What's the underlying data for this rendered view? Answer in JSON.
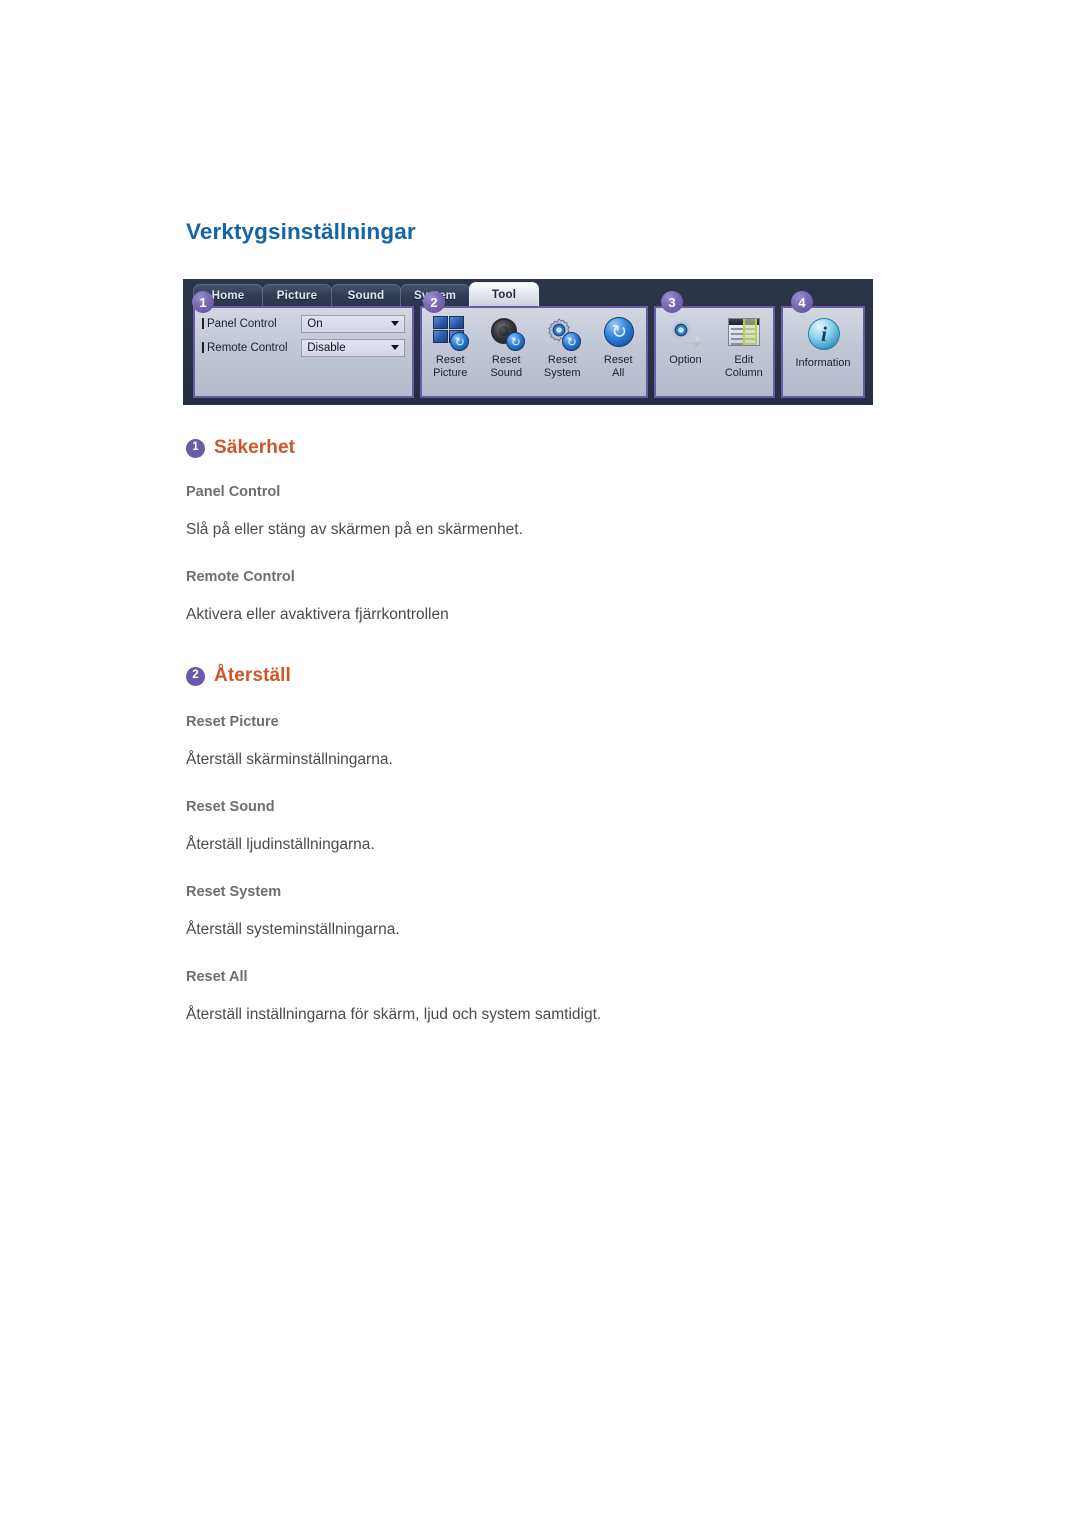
{
  "page": {
    "title": "Verktygsinställningar"
  },
  "figure": {
    "name": "tool-tab-toolbar-screenshot",
    "tabs": [
      {
        "label": "Home",
        "active": false
      },
      {
        "label": "Picture",
        "active": false
      },
      {
        "label": "Sound",
        "active": false
      },
      {
        "label": "System",
        "active": false
      },
      {
        "label": "Tool",
        "active": true
      }
    ],
    "callouts": [
      "1",
      "2",
      "3",
      "4"
    ],
    "group1": {
      "settings": [
        {
          "label": "Panel Control",
          "value": "On"
        },
        {
          "label": "Remote Control",
          "value": "Disable"
        }
      ]
    },
    "group2": {
      "buttons": [
        {
          "label": "Reset\nPicture",
          "icon": "reset-picture-icon"
        },
        {
          "label": "Reset\nSound",
          "icon": "reset-sound-icon"
        },
        {
          "label": "Reset\nSystem",
          "icon": "reset-system-icon"
        },
        {
          "label": "Reset\nAll",
          "icon": "reset-all-icon"
        }
      ]
    },
    "group3": {
      "buttons": [
        {
          "label": "Option",
          "icon": "option-icon"
        },
        {
          "label": "Edit\nColumn",
          "icon": "edit-column-icon"
        }
      ]
    },
    "group4": {
      "buttons": [
        {
          "label": "Information",
          "icon": "information-icon"
        }
      ]
    }
  },
  "sections": [
    {
      "number": "1",
      "title": "Säkerhet",
      "items": [
        {
          "head": "Panel Control",
          "text": "Slå på eller stäng av skärmen på en skärmenhet."
        },
        {
          "head": "Remote Control",
          "text": "Aktivera eller avaktivera fjärrkontrollen"
        }
      ]
    },
    {
      "number": "2",
      "title": "Återställ",
      "items": [
        {
          "head": "Reset Picture",
          "text": "Återställ skärminställningarna."
        },
        {
          "head": "Reset Sound",
          "text": "Återställ ljudinställningarna."
        },
        {
          "head": "Reset System",
          "text": "Återställ systeminställningarna."
        },
        {
          "head": "Reset All",
          "text": "Återställ inställningarna för skärm, ljud och system samtidigt."
        }
      ]
    }
  ],
  "colors": {
    "title_blue": "#1464aa",
    "section_orange": "#d2552a",
    "badge_purple": "#6a5aa8",
    "subhead_gray": "#6e6e70",
    "body_gray": "#4b4b4d",
    "figure_navy": "#2b3349"
  }
}
